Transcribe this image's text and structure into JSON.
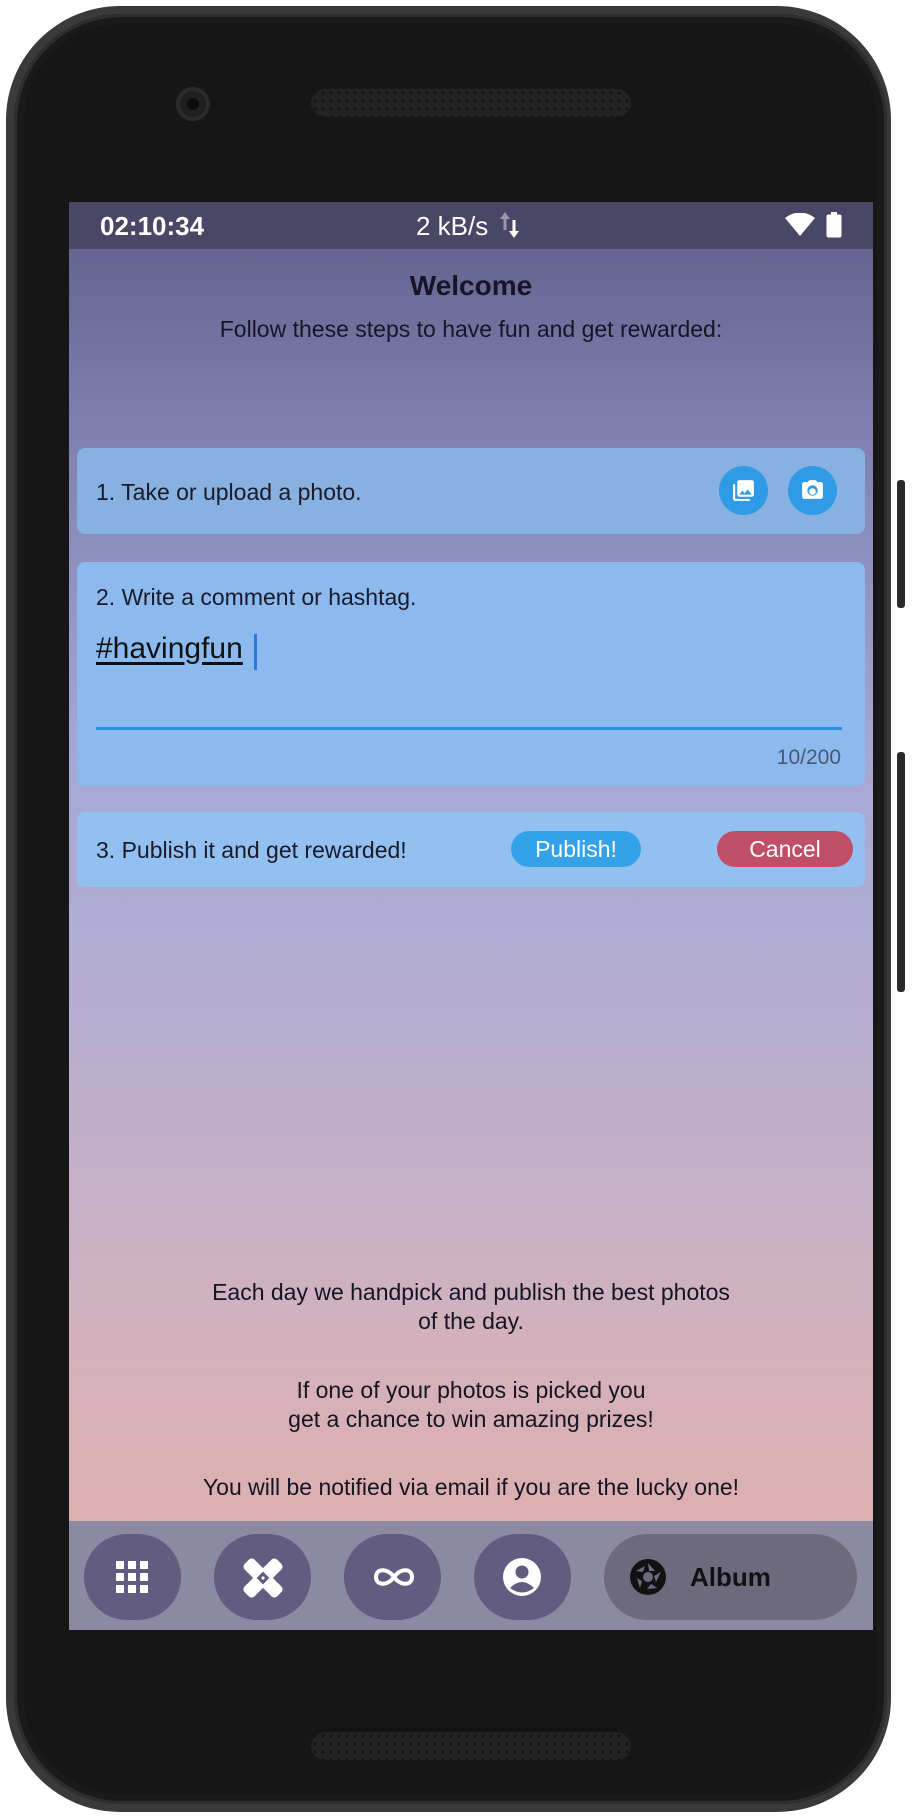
{
  "status_bar": {
    "time": "02:10:34",
    "speed": "2 kB/s",
    "icons": [
      "data-arrows-icon",
      "wifi-icon",
      "battery-icon"
    ]
  },
  "header": {
    "title": "Welcome",
    "subtitle": "Follow these steps to have fun and get rewarded:"
  },
  "step1": {
    "label": "1. Take or upload a photo.",
    "buttons": [
      "gallery-icon",
      "camera-icon"
    ]
  },
  "step2": {
    "label": "2. Write a comment or hashtag.",
    "input_value": "#havingfun",
    "counter": "10/200"
  },
  "step3": {
    "label": "3. Publish it and get rewarded!",
    "publish_label": "Publish!",
    "cancel_label": "Cancel"
  },
  "info": {
    "para1_line1": "Each day we handpick and publish the best photos",
    "para1_line2": "of the day.",
    "para2_line1": "If one of your photos is picked you",
    "para2_line2": "get a chance to win amazing prizes!",
    "para3": "You will be notified via email if you are the lucky one!"
  },
  "nav": {
    "items": [
      "apps-grid-icon",
      "bandage-icon",
      "infinity-icon",
      "account-icon"
    ],
    "album_label": "Album"
  },
  "colors": {
    "accent": "#2f9ae5",
    "cancel": "#c04e66",
    "status_bar": "#4a4665",
    "nav_bar": "#8c8aa3"
  }
}
